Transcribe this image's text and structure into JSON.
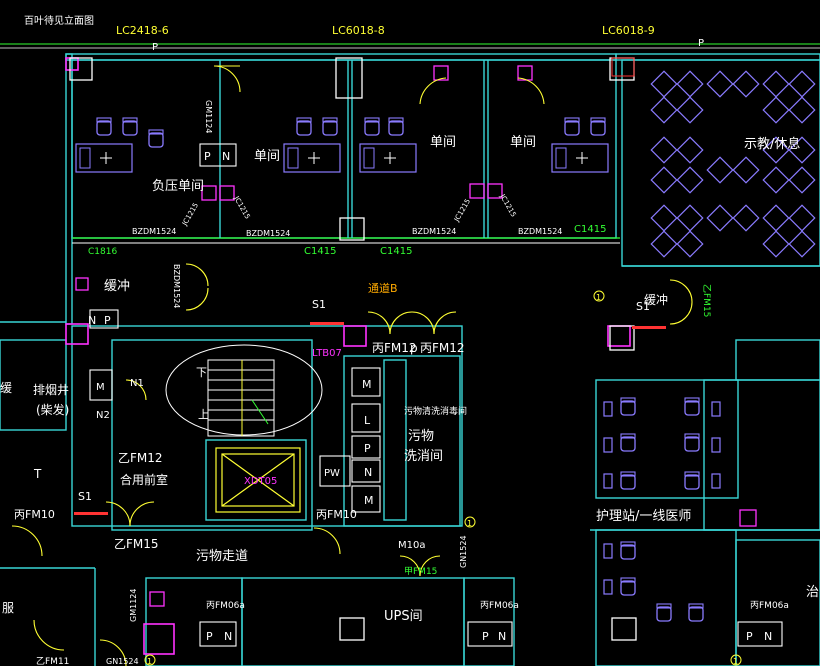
{
  "colors": {
    "background": "#000000",
    "wall": "#39d6d6",
    "wall_inner": "#ffffff",
    "label_white": "#ffffff",
    "label_green": "#33ff33",
    "label_yellow": "#ffff33",
    "label_magenta": "#ff33ff",
    "furniture": "#8a7bff",
    "door": "#ffff33",
    "axis": "#33ff33",
    "red": "#ff3333"
  },
  "labels": {
    "top_left_sign": "百叶待见立面图",
    "lc2418": "LC2418-6",
    "lc6018_a": "LC6018-8",
    "lc6018_b": "LC6018-9",
    "p1": "P",
    "p2": "P",
    "p3": "P",
    "gm1124": "GM1124",
    "negative_pressure_room": "负压单间",
    "single_room_a": "单间",
    "single_room_b": "单间",
    "single_room_c": "单间",
    "teaching_rest": "示教/休息",
    "pn_p": "P",
    "pn_n": "N",
    "bzdm1524_a": "BZDM1524",
    "bzdm1524_b": "BZDM1524",
    "bzdm1524_c": "BZDM1524",
    "bzdm1524_d": "BZDM1524",
    "bzdm1524_v": "BZDM1524",
    "jc1215_a": "JC1215",
    "jc1215_b": "JC1215",
    "jc1215_c": "JC1215",
    "jc1215_d": "JC1215",
    "c1816": "C1816",
    "c1415_a": "C1415",
    "c1415_b": "C1415",
    "c1415_c": "C1415",
    "buffer_left": "缓冲",
    "buffer_right": "缓冲",
    "passage_b": "通道B",
    "s1_a": "S1",
    "s1_b": "S1",
    "s1_c": "S1",
    "np_n": "N",
    "np_p": "P",
    "ltb07": "LTB07",
    "bfm12_a": "丙FM12",
    "bfm12_p": "p",
    "bfm12_b": "丙FM12",
    "pipe_shaft": "排烟井",
    "pipe_shaft_2": "(柴发)",
    "m_label": "M",
    "n1": "N1",
    "n2": "N2",
    "stair_down": "下",
    "stair_up": "上",
    "xdt05": "XDT05",
    "yfm12": "乙FM12",
    "combined_vestibule": "合用前室",
    "t_label": "T",
    "bfm10_a": "丙FM10",
    "bfm10_b": "丙FM10",
    "yfm15": "乙FM15",
    "dirty_corridor": "污物走道",
    "shaft_m1": "M",
    "shaft_l": "L",
    "shaft_p": "P",
    "shaft_n": "N",
    "shaft_m2": "M",
    "shaft_pw": "PW",
    "shaft_m3": "M",
    "sewage_title": "污物清洗消毒间",
    "sewage": "污物",
    "wash": "洗消间",
    "m10a": "M10a",
    "gn1524_a": "GN1524",
    "gn1524_b": "GN1524",
    "gm1124_b": "GM1124",
    "gfm15": "甲FM15",
    "ups": "UPS间",
    "bfm06a_a": "丙FM06a",
    "bfm06a_b": "丙FM06a",
    "bfm06a_c": "丙FM06a",
    "bottom_p1": "P",
    "bottom_n1": "N",
    "bottom_p2": "P",
    "bottom_n2": "N",
    "bottom_p3": "P",
    "bottom_n3": "N",
    "nurse_station": "护理站/一线医师",
    "treatment": "治",
    "yfm11": "乙FM11",
    "clothes": "服",
    "cut_left": "缓",
    "gfm15_right": "乙FM15"
  },
  "axis_markers": [
    "1",
    "1",
    "1",
    "1"
  ]
}
